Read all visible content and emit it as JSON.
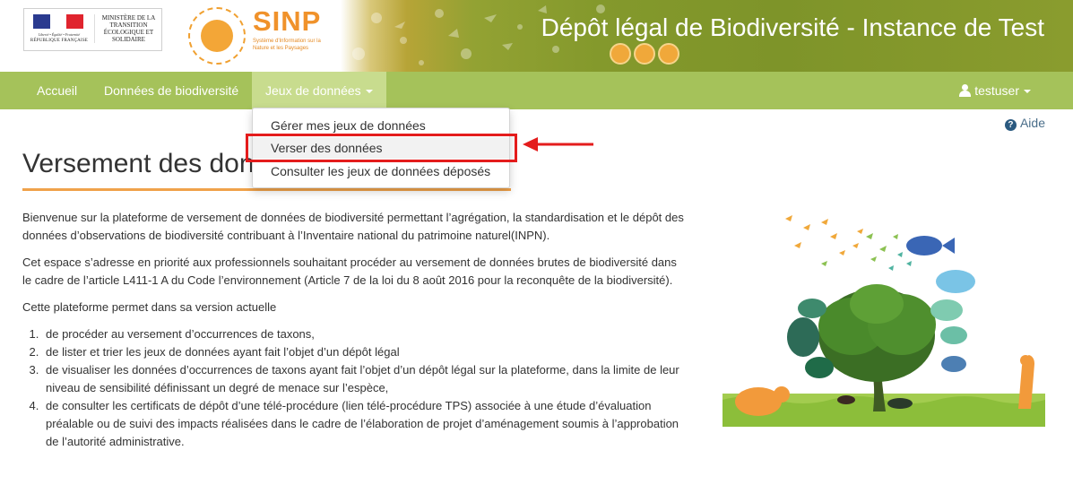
{
  "banner": {
    "republic": {
      "motto": "Liberté • Égalité • Fraternité",
      "name": "RÉPUBLIQUE FRANÇAISE",
      "ministry": "MINISTÈRE DE LA TRANSITION ÉCOLOGIQUE ET SOLIDAIRE"
    },
    "sinp": {
      "name": "SINP",
      "subtitle": "Système d'Information sur la Nature et les Paysages"
    },
    "site_title": "Dépôt légal de Biodiversité - Instance de Test",
    "colors": {
      "banner_green": "#84992c",
      "sinp_orange": "#f0922b"
    }
  },
  "nav": {
    "items": [
      {
        "label": "Accueil"
      },
      {
        "label": "Données de biodiversité"
      },
      {
        "label": "Jeux de données"
      }
    ],
    "user": "testuser",
    "colors": {
      "bar": "#a5c25a",
      "active": "#c8dc8e"
    }
  },
  "dropdown": {
    "items": [
      {
        "label": "Gérer mes jeux de données"
      },
      {
        "label": "Verser des données"
      },
      {
        "label": "Consulter les jeux de données déposés"
      }
    ],
    "highlight_color": "#e41c1c"
  },
  "help": {
    "label": "Aide"
  },
  "page": {
    "title": "Versement des données",
    "intro": "Bienvenue sur la plateforme de versement de données de biodiversité permettant l’agrégation, la standardisation et le dépôt des données d’observations de biodiversité contribuant à l’Inventaire national du patrimoine naturel(INPN).",
    "audience": "Cet espace s’adresse en priorité aux professionnels souhaitant procéder au versement de données brutes de biodiversité dans le cadre de l’article L411-1 A du Code l’environnement (Article 7 de la loi du 8 août 2016 pour la reconquête de la biodiversité).",
    "features_intro": "Cette plateforme permet dans sa version actuelle",
    "features": [
      "de procéder au versement d’occurrences de taxons,",
      "de lister et trier les jeux de données ayant fait l’objet d’un dépôt légal",
      "de visualiser les données d’occurrences de taxons ayant fait l’objet d’un dépôt légal sur la plateforme, dans la limite de leur niveau de sensibilité définissant un degré de menace sur l’espèce,",
      "de consulter les certificats de dépôt d’une télé-procédure (lien télé-procédure TPS) associée à une étude d’évaluation préalable ou de suivi des impacts réalisées dans le cadre de l’élaboration de projet d’aménagement soumis à l’approbation de l’autorité administrative."
    ],
    "accent_color": "#f0a24a"
  }
}
